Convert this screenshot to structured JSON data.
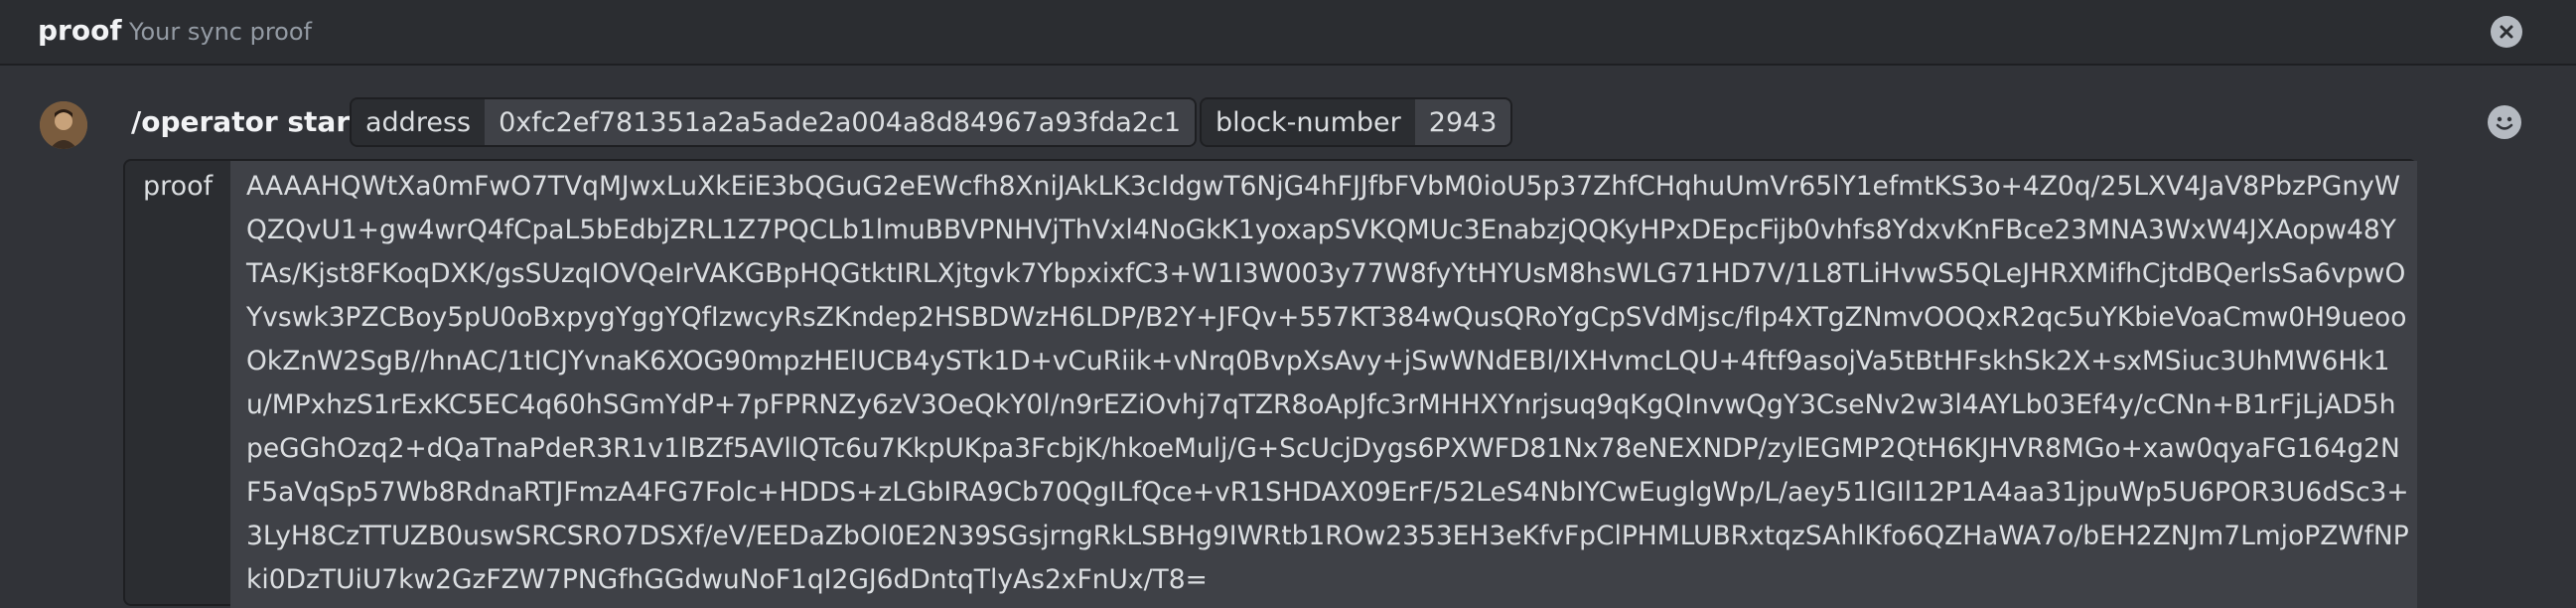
{
  "header": {
    "title": "proof",
    "subtitle": "Your sync proof"
  },
  "message": {
    "command": "/operator start",
    "options": [
      {
        "name": "address",
        "value": "0xfc2ef781351a2a5ade2a004a8d84967a93fda2c1"
      },
      {
        "name": "block-number",
        "value": "2943"
      }
    ],
    "proof": {
      "name": "proof",
      "value": "AAAAHQWtXa0mFwO7TVqMJwxLuXkEiE3bQGuG2eEWcfh8XniJAkLK3cIdgwT6NjG4hFJJfbFVbM0ioU5p37ZhfCHqhuUmVr65lY1efmtKS3o+4Z0q/25LXV4JaV8PbzPGnyWQZQvU1+gw4wrQ4fCpaL5bEdbjZRL1Z7PQCLb1lmuBBVPNHVjThVxl4NoGkK1yoxapSVKQMUc3EnabzjQQKyHPxDEpcFijb0vhfs8YdxvKnFBce23MNA3WxW4JXAopw48YTAs/Kjst8FKoqDXK/gsSUzqIOVQeIrVAKGBpHQGtktIRLXjtgvk7YbpxixfC3+W1I3W003y77W8fyYtHYUsM8hsWLG71HD7V/1L8TLiHvwS5QLeJHRXMifhCjtdBQerlsSa6vpwOYvswk3PZCBoy5pU0oBxpygYggYQfIzwcyRsZKndep2HSBDWzH6LDP/B2Y+JFQv+557KT384wQusQRoYgCpSVdMjsc/fIp4XTgZNmvOOQxR2qc5uYKbieVoaCmw0H9ueooOkZnW2SgB//hnAC/1tICJYvnaK6XOG90mpzHElUCB4ySTk1D+vCuRiik+vNrq0BvpXsAvy+jSwWNdEBl/IXHvmcLQU+4ftf9asojVa5tBtHFskhSk2X+sxMSiuc3UhMW6Hk1u/MPxhzS1rExKC5EC4q60hSGmYdP+7pFPRNZy6zV3OeQkY0l/n9rEZiOvhj7qTZR8oApJfc3rMHHXYnrjsuq9qKgQInvwQgY3CseNv2w3l4AYLb03Ef4y/cCNn+B1rFjLjAD5hpeGGhOzq2+dQaTnaPdeR3R1v1lBZf5AVllQTc6u7KkpUKpa3FcbjK/hkoeMulj/G+ScUcjDygs6PXWFD81Nx78eNEXNDP/zylEGMP2QtH6KJHVR8MGo+xaw0qyaFG164g2NF5aVqSp57Wb8RdnaRTJFmzA4FG7Folc+HDDS+zLGbIRA9Cb70QgILfQce+vR1SHDAX09ErF/52LeS4NbIYCwEuglgWp/L/aey51lGIl12P1A4aa31jpuWp5U6POR3U6dSc3+3LyH8CzTTUZB0uswSRCSRO7DSXf/eV/EEDaZbOl0E2N39SGsjrngRkLSBHg9IWRtb1ROw2353EH3eKfvFpClPHMLUBRxtqzSAhlKfo6QZHaWA7o/bEH2ZNJm7LmjoPZWfNPki0DzTUiU7kw2GzFZW7PNGfhGGdwuNoF1qI2GJ6dDntqTlyAs2xFnUx/T8="
    }
  },
  "icons": {
    "close": "close-icon",
    "emoji": "emoji-smile-icon",
    "avatar": "user-avatar"
  },
  "colors": {
    "background": "#313338",
    "header": "#2b2d31",
    "chip_value": "#3f4147"
  }
}
